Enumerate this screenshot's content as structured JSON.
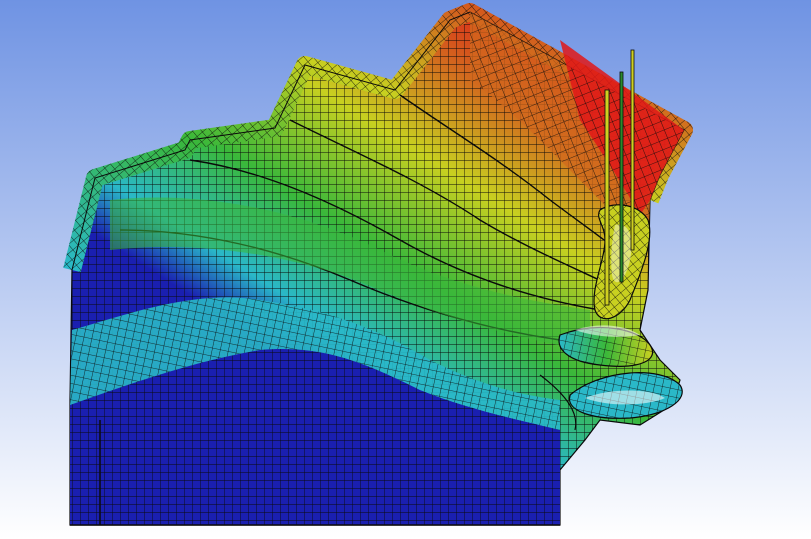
{
  "viewport": {
    "background_top": "#6f93e3",
    "background_bottom": "#ffffff",
    "mesh_line_color": "#0a0a0a",
    "contour_colors": [
      "#1a1fb0",
      "#2ab8c8",
      "#3ab83a",
      "#c8d020",
      "#d2691e",
      "#e01818"
    ]
  },
  "model": {
    "kind": "meshed-folded-shell",
    "contour_legend_visible": false,
    "probes": [
      {
        "color": "#cfcf20"
      },
      {
        "color": "#2a8a2a"
      },
      {
        "color": "#cfcf20"
      }
    ]
  }
}
